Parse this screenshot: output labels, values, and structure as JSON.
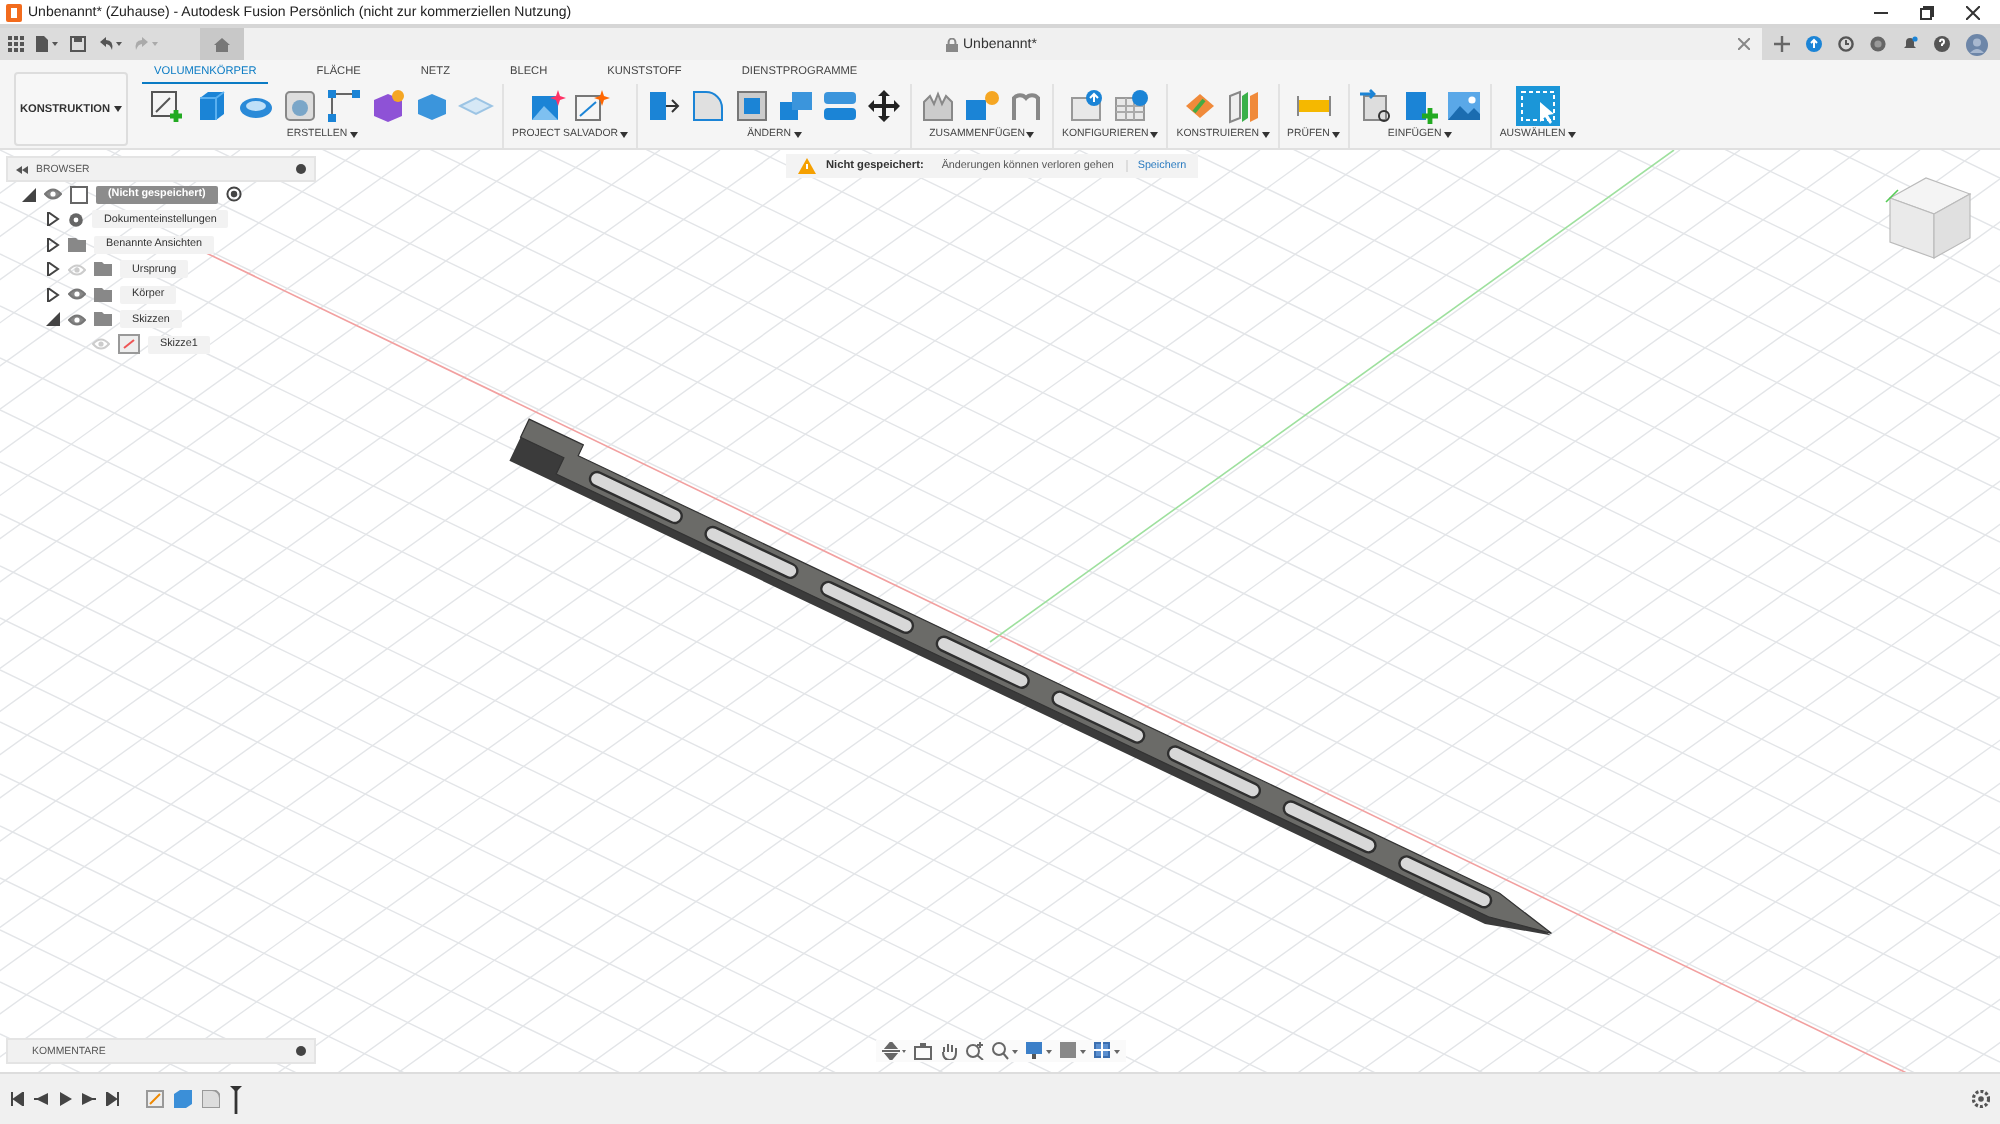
{
  "window": {
    "title": "Unbenannt* (Zuhause) - Autodesk Fusion Persönlich (nicht zur kommerziellen Nutzung)"
  },
  "document_tab": {
    "title": "Unbenannt*"
  },
  "workspace": {
    "label": "KONSTRUKTION"
  },
  "tabs": [
    {
      "label": "VOLUMENKÖRPER",
      "selected": true
    },
    {
      "label": "FLÄCHE",
      "selected": false
    },
    {
      "label": "NETZ",
      "selected": false
    },
    {
      "label": "BLECH",
      "selected": false
    },
    {
      "label": "KUNSTSTOFF",
      "selected": false
    },
    {
      "label": "DIENSTPROGRAMME",
      "selected": false
    }
  ],
  "tool_groups": [
    {
      "label": "ERSTELLEN"
    },
    {
      "label": "PROJECT SALVADOR"
    },
    {
      "label": "ÄNDERN"
    },
    {
      "label": "ZUSAMMENFÜGEN"
    },
    {
      "label": "KONFIGURIEREN"
    },
    {
      "label": "KONSTRUIEREN"
    },
    {
      "label": "PRÜFEN"
    },
    {
      "label": "EINFÜGEN"
    },
    {
      "label": "AUSWÄHLEN"
    }
  ],
  "notification": {
    "title": "Nicht gespeichert:",
    "message": "Änderungen können verloren gehen",
    "action": "Speichern"
  },
  "browser": {
    "title": "BROWSER",
    "tree": [
      {
        "label": "(Nicht gespeichert)",
        "kind": "document",
        "expanded": true,
        "visible": true,
        "children": [
          {
            "label": "Dokumenteinstellungen",
            "kind": "settings",
            "expanded": false
          },
          {
            "label": "Benannte Ansichten",
            "kind": "folder",
            "expanded": false
          },
          {
            "label": "Ursprung",
            "kind": "folder",
            "expanded": false,
            "visible": false
          },
          {
            "label": "Körper",
            "kind": "folder",
            "expanded": false,
            "visible": true
          },
          {
            "label": "Skizzen",
            "kind": "folder",
            "expanded": true,
            "visible": true,
            "children": [
              {
                "label": "Skizze1",
                "kind": "sketch",
                "visible": false
              }
            ]
          }
        ]
      }
    ]
  },
  "comments": {
    "title": "KOMMENTARE"
  }
}
